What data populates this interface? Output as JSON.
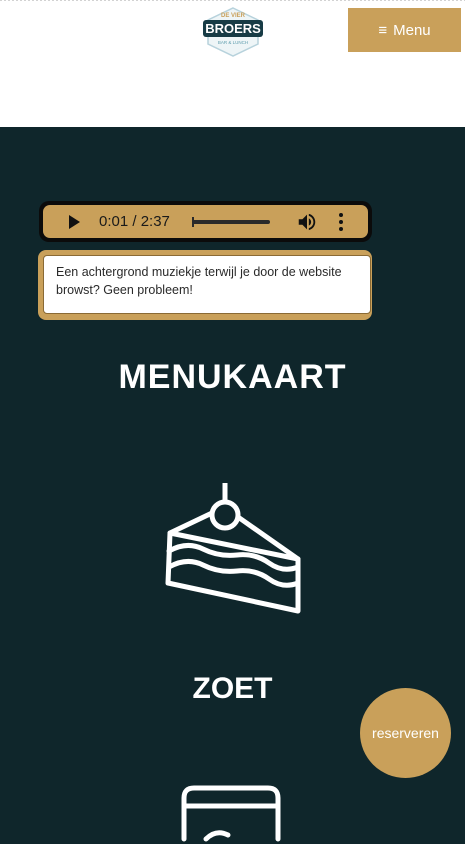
{
  "header": {
    "logo": {
      "top_text": "DE VIER",
      "brand": "BROERS",
      "bottom_text": "BAR & LUNCH"
    },
    "menu_button": {
      "icon": "hamburger-icon",
      "label": "Menu"
    }
  },
  "audio_player": {
    "time_display": "0:01 / 2:37",
    "progress_fraction": 0.0064
  },
  "tooltip": {
    "text": "Een achtergrond muziekje terwijl je door de website browst? Geen probleem!"
  },
  "page_title": "MENUKAART",
  "categories": [
    {
      "icon": "cake-slice-icon",
      "label": "ZOET"
    }
  ],
  "floating_button": {
    "label": "reserveren"
  },
  "colors": {
    "accent": "#c9a05a",
    "background": "#0f262b",
    "header": "#ffffff"
  }
}
